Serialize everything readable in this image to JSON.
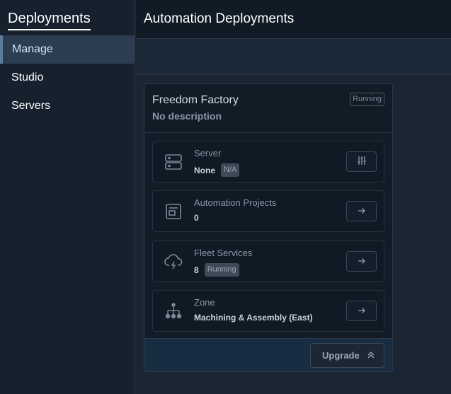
{
  "sidebar": {
    "title": "Deployments",
    "items": [
      {
        "label": "Manage"
      },
      {
        "label": "Studio"
      },
      {
        "label": "Servers"
      }
    ]
  },
  "header": {
    "title": "Automation Deployments"
  },
  "card": {
    "title": "Freedom Factory",
    "description": "No description",
    "status": "Running",
    "rows": [
      {
        "label": "Server",
        "value": "None",
        "tag": "N/A",
        "icon": "server-icon",
        "action_icon": "sliders-icon"
      },
      {
        "label": "Automation Projects",
        "value": "0",
        "icon": "project-icon",
        "action_icon": "arrow-right-icon"
      },
      {
        "label": "Fleet Services",
        "value": "8",
        "tag": "Running",
        "icon": "cloud-lightning-icon",
        "action_icon": "arrow-right-icon"
      },
      {
        "label": "Zone",
        "value": "Machining & Assembly (East)",
        "icon": "hierarchy-icon",
        "action_icon": "arrow-right-icon"
      }
    ],
    "footer": {
      "upgrade_label": "Upgrade"
    }
  }
}
